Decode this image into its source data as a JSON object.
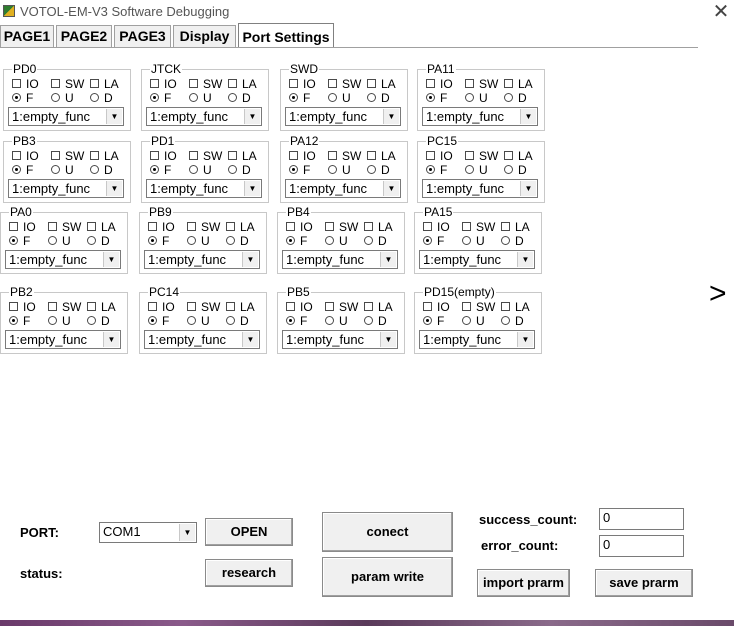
{
  "window": {
    "title": "VOTOL-EM-V3 Software Debugging",
    "close_glyph": "✕"
  },
  "tabs": [
    {
      "label": "PAGE1",
      "active": false
    },
    {
      "label": "PAGE2",
      "active": false
    },
    {
      "label": "PAGE3",
      "active": false
    },
    {
      "label": "Display",
      "active": false
    },
    {
      "label": "Port Settings",
      "active": true
    }
  ],
  "option_labels": {
    "io": "IO",
    "sw": "SW",
    "la": "LA",
    "f": "F",
    "u": "U",
    "d": "D"
  },
  "pins": [
    {
      "name": "PD0",
      "mode": "F",
      "func": "1:empty_func"
    },
    {
      "name": "JTCK",
      "mode": "F",
      "func": "1:empty_func"
    },
    {
      "name": "SWD",
      "mode": "F",
      "func": "1:empty_func"
    },
    {
      "name": "PA11",
      "mode": "F",
      "func": "1:empty_func"
    },
    {
      "name": "PB3",
      "mode": "F",
      "func": "1:empty_func"
    },
    {
      "name": "PD1",
      "mode": "F",
      "func": "1:empty_func"
    },
    {
      "name": "PA12",
      "mode": "F",
      "func": "1:empty_func"
    },
    {
      "name": "PC15",
      "mode": "F",
      "func": "1:empty_func"
    },
    {
      "name": "PA0",
      "mode": "F",
      "func": "1:empty_func"
    },
    {
      "name": "PB9",
      "mode": "F",
      "func": "1:empty_func"
    },
    {
      "name": "PB4",
      "mode": "F",
      "func": "1:empty_func"
    },
    {
      "name": "PA15",
      "mode": "F",
      "func": "1:empty_func"
    },
    {
      "name": "PB2",
      "mode": "F",
      "func": "1:empty_func"
    },
    {
      "name": "PC14",
      "mode": "F",
      "func": "1:empty_func"
    },
    {
      "name": "PB5",
      "mode": "F",
      "func": "1:empty_func"
    },
    {
      "name": "PD15(empty)",
      "mode": "F",
      "func": "1:empty_func"
    }
  ],
  "next_glyph": ">",
  "serial": {
    "port_label": "PORT:",
    "port_value": "COM1",
    "open_label": "OPEN",
    "status_label": "status:",
    "research_label": "research",
    "connect_label": "conect",
    "param_write_label": "param write",
    "success_label": "success_count:",
    "success_value": "0",
    "error_label": "error_count:",
    "error_value": "0",
    "import_label": "import prarm",
    "save_label": "save prarm"
  }
}
